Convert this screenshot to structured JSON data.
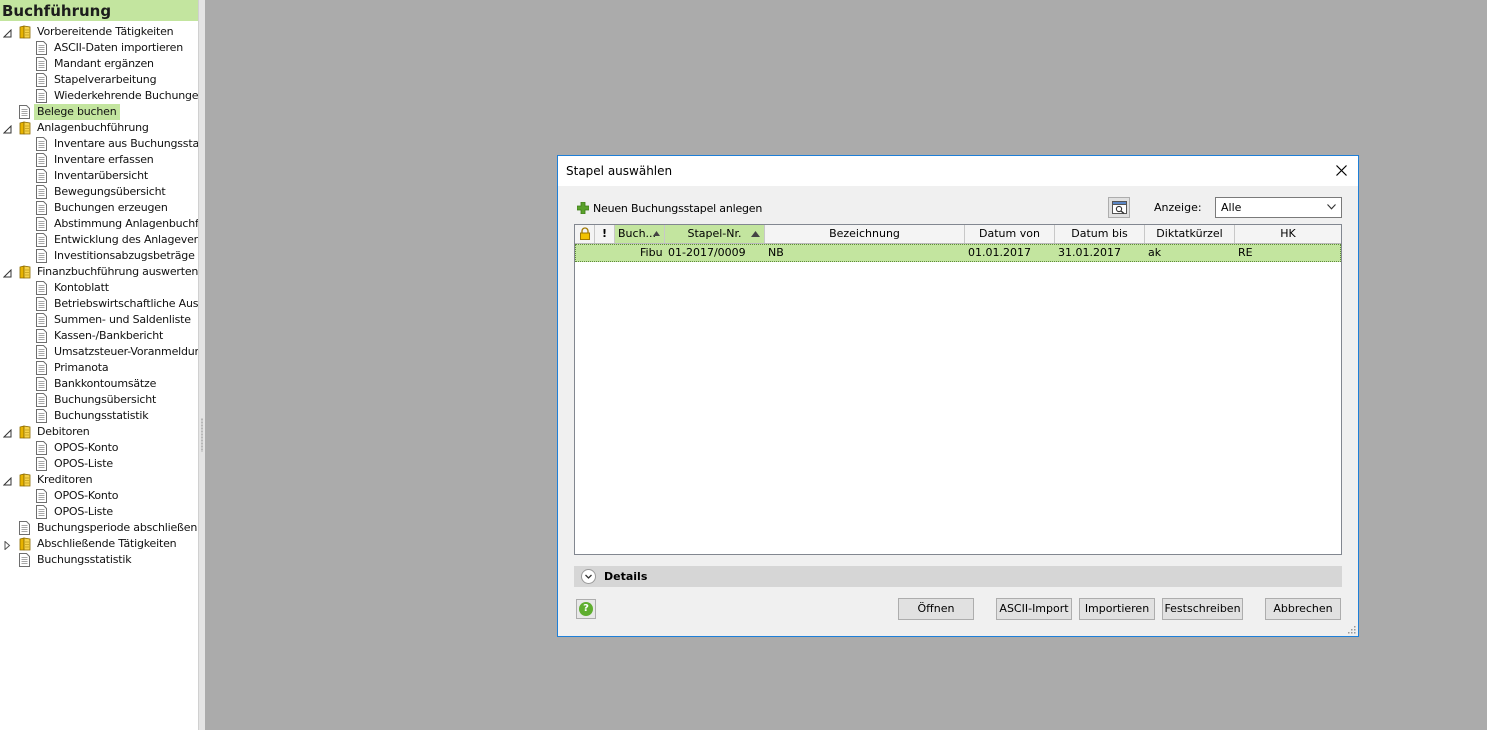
{
  "sidebar": {
    "title": "Buchführung",
    "items": [
      {
        "label": "Vorbereitende Tätigkeiten",
        "level": 0,
        "type": "folder",
        "expander": "expanded"
      },
      {
        "label": "ASCII-Daten importieren",
        "level": 1,
        "type": "doc"
      },
      {
        "label": "Mandant ergänzen",
        "level": 1,
        "type": "doc"
      },
      {
        "label": "Stapelverarbeitung",
        "level": 1,
        "type": "doc"
      },
      {
        "label": "Wiederkehrende Buchunge...",
        "level": 1,
        "type": "doc"
      },
      {
        "label": "Belege buchen",
        "level": 0,
        "type": "doc",
        "selected": true
      },
      {
        "label": "Anlagenbuchführung",
        "level": 0,
        "type": "folder",
        "expander": "expanded"
      },
      {
        "label": "Inventare aus Buchungssta...",
        "level": 1,
        "type": "doc"
      },
      {
        "label": "Inventare erfassen",
        "level": 1,
        "type": "doc"
      },
      {
        "label": "Inventarübersicht",
        "level": 1,
        "type": "doc"
      },
      {
        "label": "Bewegungsübersicht",
        "level": 1,
        "type": "doc"
      },
      {
        "label": "Buchungen erzeugen",
        "level": 1,
        "type": "doc"
      },
      {
        "label": "Abstimmung Anlagenbuchf...",
        "level": 1,
        "type": "doc"
      },
      {
        "label": "Entwicklung des Anlagever...",
        "level": 1,
        "type": "doc"
      },
      {
        "label": "Investitionsabzugsbeträge",
        "level": 1,
        "type": "doc"
      },
      {
        "label": "Finanzbuchführung auswerten",
        "level": 0,
        "type": "folder",
        "expander": "expanded"
      },
      {
        "label": "Kontoblatt",
        "level": 1,
        "type": "doc"
      },
      {
        "label": "Betriebswirtschaftliche Aus...",
        "level": 1,
        "type": "doc"
      },
      {
        "label": "Summen- und Saldenliste",
        "level": 1,
        "type": "doc"
      },
      {
        "label": "Kassen-/Bankbericht",
        "level": 1,
        "type": "doc"
      },
      {
        "label": "Umsatzsteuer-Voranmeldung",
        "level": 1,
        "type": "doc"
      },
      {
        "label": "Primanota",
        "level": 1,
        "type": "doc"
      },
      {
        "label": "Bankkontoumsätze",
        "level": 1,
        "type": "doc"
      },
      {
        "label": "Buchungsübersicht",
        "level": 1,
        "type": "doc"
      },
      {
        "label": "Buchungsstatistik",
        "level": 1,
        "type": "doc"
      },
      {
        "label": "Debitoren",
        "level": 0,
        "type": "folder",
        "expander": "expanded"
      },
      {
        "label": "OPOS-Konto",
        "level": 1,
        "type": "doc"
      },
      {
        "label": "OPOS-Liste",
        "level": 1,
        "type": "doc"
      },
      {
        "label": "Kreditoren",
        "level": 0,
        "type": "folder",
        "expander": "expanded"
      },
      {
        "label": "OPOS-Konto",
        "level": 1,
        "type": "doc"
      },
      {
        "label": "OPOS-Liste",
        "level": 1,
        "type": "doc"
      },
      {
        "label": "Buchungsperiode abschließen",
        "level": 0,
        "type": "doc"
      },
      {
        "label": "Abschließende Tätigkeiten",
        "level": 0,
        "type": "folder",
        "expander": "collapsed"
      },
      {
        "label": "Buchungsstatistik",
        "level": 0,
        "type": "doc"
      }
    ]
  },
  "dialog": {
    "title": "Stapel auswählen",
    "new_batch_label": "Neuen Buchungsstapel anlegen",
    "anzeige_label": "Anzeige:",
    "anzeige_value": "Alle",
    "columns": [
      "",
      "!",
      "Buch...",
      "Stapel-Nr.",
      "Bezeichnung",
      "Datum von",
      "Datum bis",
      "Diktatkürzel",
      "HK"
    ],
    "rows": [
      {
        "cells": [
          "",
          "",
          "Fibu",
          "01-2017/0009",
          "NB",
          "01.01.2017",
          "31.01.2017",
          "ak",
          "RE"
        ]
      }
    ],
    "details_label": "Details",
    "help_symbol": "?",
    "buttons": {
      "open": "Öffnen",
      "ascii_import": "ASCII-Import",
      "import": "Importieren",
      "commit": "Festschreiben",
      "cancel": "Abbrechen"
    }
  },
  "colors": {
    "accent_green": "#c3e59f",
    "dialog_border": "#1e7fd8",
    "workspace": "#ababab"
  }
}
